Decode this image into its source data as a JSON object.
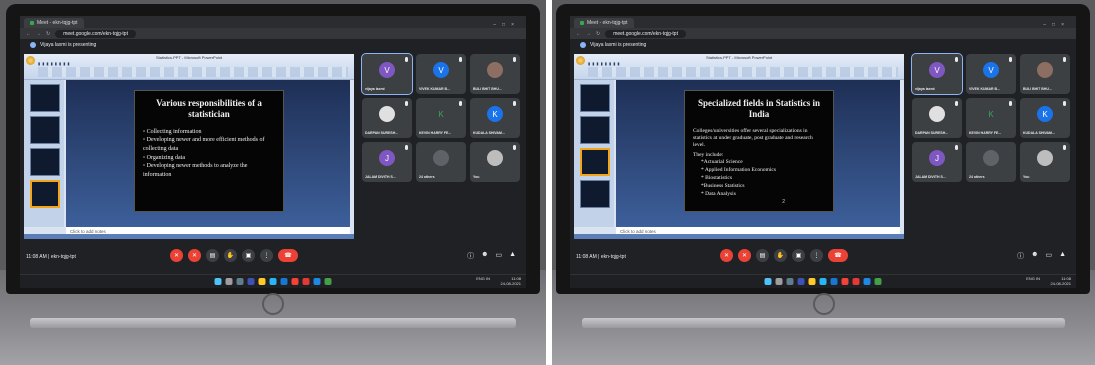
{
  "browser": {
    "tab_title": "Meet - ekn-tqjg-tpt",
    "url": "meet.google.com/ekn-tqjg-tpt",
    "presenting_text": "Vijaya laxmi is presenting"
  },
  "powerpoint": {
    "window_title": "Statistics.PPT - Microsoft PowerPoint",
    "notes_placeholder": "Click to add notes"
  },
  "left": {
    "slide": {
      "title": "Various responsibilities of a statistician",
      "bullets": [
        "Collecting information",
        "Developing newer and more efficient methods of collecting data",
        "Organizing data",
        "Developing newer methods to analyze the information"
      ]
    }
  },
  "right": {
    "slide": {
      "title": "Specialized fields in Statistics in India",
      "paragraph": "Colleges/universities offer several specializations in statistics at under graduate, post graduate and research level.",
      "they_include": "They include:",
      "items": [
        "*Actuarial Science",
        "* Applied Information Economics",
        "* Biostatistics",
        "*Business Statistics",
        "* Data Analysis"
      ],
      "page_number": "2"
    }
  },
  "participants": [
    {
      "initial": "V",
      "name": "vijaya laxmi",
      "color": "#7e57c2"
    },
    {
      "initial": "V",
      "name": "VIVEK KUMAR B...",
      "color": "#1a73e8"
    },
    {
      "initial": "",
      "name": "BULI BHIT BHU...",
      "color": "#8d6e63"
    },
    {
      "initial": "",
      "name": "DARPAN SURESH...",
      "color": "#e0e0e0"
    },
    {
      "initial": "K",
      "name": "KEVIN HARRY FE...",
      "color": "#188038"
    },
    {
      "initial": "K",
      "name": "KUDALA SHIVAM...",
      "color": "#1a73e8"
    },
    {
      "initial": "J",
      "name": "JALAM DIVITH S...",
      "color": "#7e57c2"
    },
    {
      "initial": "",
      "name": "24 others",
      "color": "#5f6368"
    },
    {
      "initial": "",
      "name": "You",
      "color": "#bdbdbd"
    }
  ],
  "meeting": {
    "time": "11:08 AM",
    "code": "ekn-tqjg-tpt"
  },
  "taskbar": {
    "lang": "ENG IN",
    "time": "11:08",
    "date": "24-08-2021"
  },
  "device": {
    "logo": "hp"
  }
}
